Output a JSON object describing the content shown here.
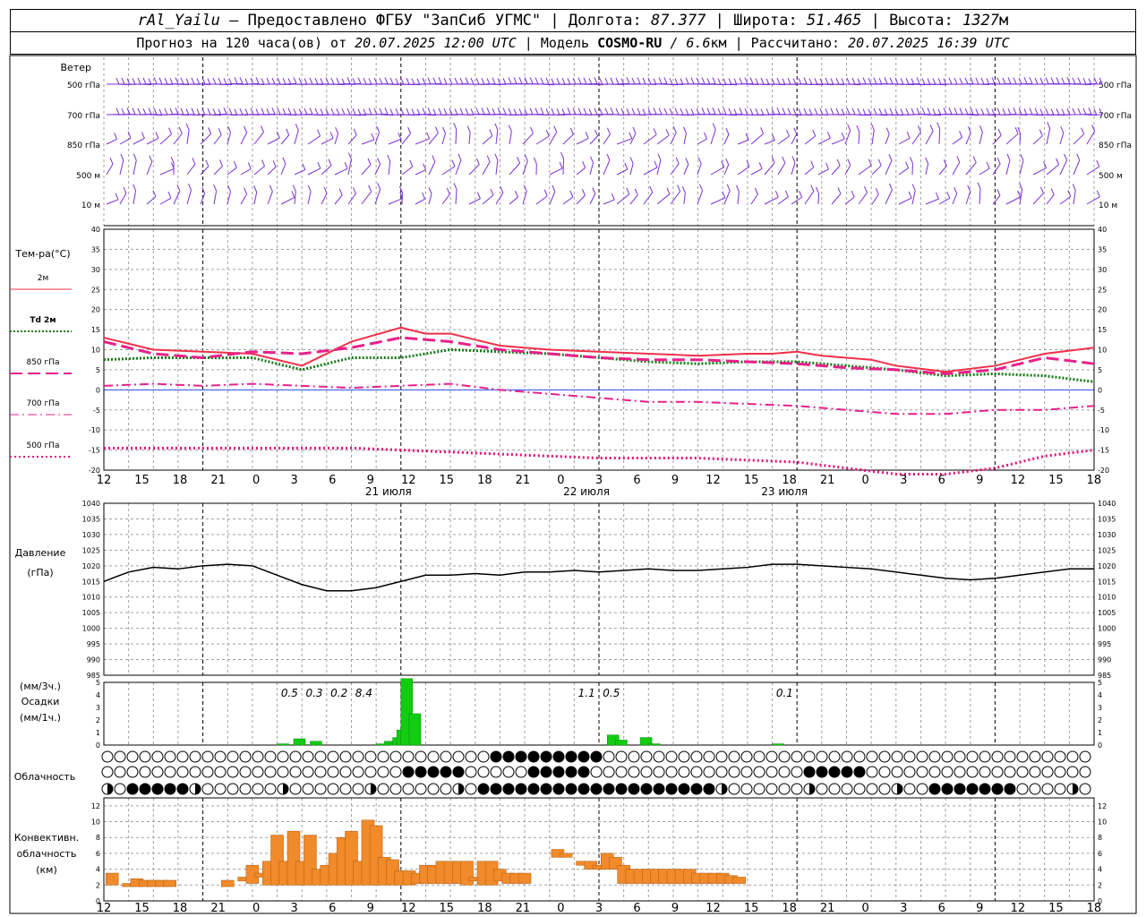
{
  "header": {
    "station": "rAl_Yailu",
    "provider_prefix": " — Предоставлено ФГБУ \"ЗапСиб УГМС\" | Долгота: ",
    "lon": "87.377",
    "lat_prefix": " | Широта: ",
    "lat": "51.465",
    "alt_prefix": " | Высота: ",
    "alt": "1327",
    "alt_unit": "м",
    "line2_prefix": "Прогноз на 120 часа(ов) от ",
    "forecast_from": "20.07.2025 12:00 UTC",
    "model_prefix": " | Модель ",
    "model": "COSMO-RU",
    "model_res": " / 6.6",
    "model_res_unit": "км",
    "calc_prefix": " | Рассчитано: ",
    "calculated": "20.07.2025 16:39 UTC"
  },
  "colors": {
    "wind": "#7a2fd6",
    "t2m": "#f0304a",
    "td2m": "#157a15",
    "t850": "#e8208a",
    "t700": "#e8208a",
    "t500": "#e0107a",
    "pressure": "#000000",
    "precip": "#12cc12",
    "convective": "#f08a2a",
    "grid": "#a0a0a0",
    "day_line": "#000000",
    "zero_line": "#3050ff"
  },
  "time_axis": {
    "hours": [
      "12",
      "15",
      "18",
      "21",
      "0",
      "3",
      "6",
      "9",
      "12",
      "15",
      "18",
      "21",
      "0",
      "3",
      "6",
      "9",
      "12",
      "15",
      "18",
      "21",
      "0",
      "3",
      "6",
      "9",
      "12",
      "15",
      "18"
    ],
    "dates": [
      "21 июля",
      "22 июля",
      "23 июля"
    ]
  },
  "wind_panel": {
    "title": "Ветер",
    "levels": [
      "500 гПа",
      "700 гПа",
      "850 гПа",
      "500 м",
      "10 м"
    ]
  },
  "chart_data": [
    {
      "type": "line",
      "id": "temperature",
      "ylabel": "Тем-ра(°С)",
      "ylim": [
        -20,
        40
      ],
      "yticks": [
        "-20",
        "-15",
        "-10",
        "-5",
        "0",
        "5",
        "10",
        "15",
        "20",
        "25",
        "30",
        "35",
        "40"
      ],
      "series": [
        {
          "name": "2м",
          "x_hours": [
            0,
            6,
            12,
            18,
            24,
            30,
            36,
            39,
            42,
            48,
            54,
            60,
            66,
            72,
            78,
            81,
            84,
            87,
            90,
            93,
            96,
            102,
            108,
            114,
            120
          ],
          "values": [
            13,
            10,
            9.5,
            9,
            6,
            12,
            15.5,
            14,
            14,
            11,
            10,
            9.5,
            9,
            8.5,
            9,
            9,
            9.5,
            8.5,
            8,
            7.5,
            6,
            4.5,
            6,
            9,
            10.5
          ]
        },
        {
          "name": "Td 2м",
          "x_hours": [
            0,
            6,
            12,
            18,
            24,
            30,
            36,
            42,
            48,
            54,
            60,
            66,
            72,
            78,
            84,
            90,
            96,
            102,
            108,
            114,
            120
          ],
          "values": [
            7.5,
            8,
            8,
            8,
            5,
            8,
            8,
            10,
            9.5,
            9,
            8,
            7,
            6.5,
            7,
            7,
            6,
            5,
            3.5,
            4,
            3.5,
            2
          ]
        },
        {
          "name": "850 гПа",
          "x_hours": [
            0,
            6,
            12,
            18,
            24,
            30,
            36,
            42,
            48,
            54,
            60,
            66,
            72,
            78,
            84,
            90,
            96,
            102,
            108,
            114,
            120
          ],
          "values": [
            12,
            9,
            8,
            9.5,
            9,
            10.5,
            13,
            12,
            10,
            9,
            8,
            7.5,
            7.5,
            7,
            6.5,
            5.5,
            5,
            4,
            5,
            8,
            6.5
          ]
        },
        {
          "name": "700 гПа",
          "x_hours": [
            0,
            6,
            12,
            18,
            24,
            30,
            36,
            42,
            48,
            54,
            60,
            66,
            72,
            78,
            84,
            90,
            96,
            102,
            108,
            114,
            120
          ],
          "values": [
            1,
            1.5,
            1,
            1.5,
            1,
            0.5,
            1,
            1.5,
            0,
            -1,
            -2,
            -3,
            -3,
            -3.5,
            -4,
            -5,
            -6,
            -6,
            -5,
            -5,
            -4
          ]
        },
        {
          "name": "500 гПа",
          "x_hours": [
            0,
            6,
            12,
            18,
            24,
            30,
            36,
            42,
            48,
            54,
            60,
            66,
            72,
            78,
            84,
            90,
            96,
            102,
            108,
            114,
            120
          ],
          "values": [
            -14.5,
            -14.5,
            -14.5,
            -14.5,
            -14.5,
            -14.5,
            -15,
            -15.5,
            -16,
            -16.5,
            -17,
            -17,
            -17,
            -17.5,
            -18,
            -19.5,
            -21,
            -21,
            -19.5,
            -16.5,
            -15
          ]
        }
      ]
    },
    {
      "type": "line",
      "id": "pressure",
      "ylabel": "Давление",
      "yunit": "(гПа)",
      "ylim": [
        985,
        1040
      ],
      "yticks": [
        "985",
        "990",
        "995",
        "1000",
        "1005",
        "1010",
        "1015",
        "1020",
        "1025",
        "1030",
        "1035",
        "1040"
      ],
      "series": [
        {
          "x_hours": [
            0,
            3,
            6,
            9,
            12,
            15,
            18,
            21,
            24,
            27,
            30,
            33,
            36,
            39,
            42,
            45,
            48,
            51,
            54,
            57,
            60,
            63,
            66,
            69,
            72,
            75,
            78,
            81,
            84,
            87,
            90,
            93,
            96,
            99,
            102,
            105,
            108,
            111,
            114,
            117,
            120
          ],
          "values": [
            1015,
            1018,
            1019.5,
            1019,
            1020,
            1020.5,
            1020,
            1017,
            1014,
            1012,
            1012,
            1013,
            1015,
            1017,
            1017,
            1017.5,
            1017,
            1018,
            1018,
            1018.5,
            1018,
            1018.5,
            1019,
            1018.5,
            1018.5,
            1019,
            1019.5,
            1020.5,
            1020.5,
            1020,
            1019.5,
            1019,
            1018,
            1017,
            1016,
            1015.5,
            1016,
            1017,
            1018,
            1019,
            1019
          ]
        }
      ]
    },
    {
      "type": "bar",
      "id": "precipitation",
      "ylabel": "(мм/3ч.)",
      "title": "Осадки",
      "yunit": "(мм/1ч.)",
      "ylim": [
        0,
        5
      ],
      "yticks": [
        "0",
        "1",
        "2",
        "3",
        "4",
        "5"
      ],
      "bars_hour": [
        21,
        22,
        23,
        24,
        25,
        26,
        33,
        34,
        34.5,
        35,
        35.5,
        36,
        37,
        38,
        39,
        40,
        41,
        61,
        62,
        63,
        64,
        65,
        66,
        81,
        82
      ],
      "values": [
        0.1,
        0,
        0.5,
        0,
        0.3,
        0,
        0.1,
        0.3,
        0.2,
        0.6,
        1.2,
        5.3,
        2.5,
        0,
        0,
        0,
        0,
        0.8,
        0.4,
        0,
        0,
        0.6,
        0.1,
        0.1,
        0
      ],
      "labels": [
        {
          "text": "0.5",
          "x_hour": 22.5
        },
        {
          "text": "0.3",
          "x_hour": 25.5
        },
        {
          "text": "0.2",
          "x_hour": 28.5
        },
        {
          "text": "8.4",
          "x_hour": 31.5
        },
        {
          "text": "1.1",
          "x_hour": 58.5
        },
        {
          "text": "0.5",
          "x_hour": 61.5
        },
        {
          "text": "0.1",
          "x_hour": 82.5
        }
      ]
    },
    {
      "type": "table",
      "id": "cloudiness",
      "ylabel": "Облачность",
      "rows_octas": [
        [
          0,
          0,
          0,
          0,
          0,
          0,
          0,
          0,
          0,
          0,
          0,
          0,
          0,
          0,
          0,
          0,
          0,
          0,
          0,
          0,
          0,
          0,
          0,
          0,
          0,
          0,
          0,
          0,
          0,
          0,
          0,
          0,
          0,
          0,
          0,
          0,
          0,
          0,
          0,
          0,
          0,
          0,
          0,
          0,
          0,
          0,
          0,
          0,
          0,
          0,
          0,
          0,
          0,
          0,
          0,
          0,
          0,
          0,
          0,
          0,
          0,
          0,
          0,
          0,
          0,
          0,
          0,
          0,
          0,
          0,
          0,
          0,
          0,
          0,
          0,
          0,
          0,
          0,
          0,
          0,
          0,
          0,
          0,
          0,
          0,
          0,
          0,
          0,
          0,
          0,
          0,
          0,
          0,
          0,
          0,
          0,
          0,
          0,
          0,
          0,
          0,
          0,
          0,
          0,
          0,
          0,
          0,
          0,
          0,
          0,
          0,
          0,
          0,
          0,
          0,
          0,
          0,
          0,
          0,
          0,
          0
        ],
        [
          0,
          0,
          0,
          0,
          0,
          0,
          0,
          0,
          0,
          0,
          0,
          0,
          0,
          0,
          0,
          0,
          0,
          0,
          0,
          0,
          0,
          0,
          0,
          0,
          0,
          0,
          0,
          0,
          0,
          0,
          0,
          0,
          0,
          0,
          0,
          0,
          0,
          0,
          0,
          0,
          0,
          0,
          0,
          0,
          0,
          0,
          0,
          0,
          0,
          0,
          0,
          0,
          0,
          0,
          0,
          0,
          0,
          0,
          0,
          0,
          0,
          0,
          0,
          0,
          0,
          0,
          0,
          0,
          0,
          0,
          0,
          0,
          0,
          0,
          0,
          0,
          0,
          0,
          0,
          0,
          0,
          0,
          0,
          0,
          0,
          0,
          0,
          0,
          0,
          0,
          0,
          0,
          0,
          0,
          0,
          0,
          0,
          0,
          0,
          0,
          0,
          0,
          0,
          0,
          0,
          0,
          0,
          0,
          0,
          0,
          0,
          0,
          0,
          0,
          0,
          0,
          0,
          0,
          0,
          0,
          0
        ],
        [
          0,
          0,
          0,
          0,
          0,
          0,
          0,
          0,
          0,
          0,
          0,
          0,
          0,
          0,
          0,
          0,
          0,
          0,
          0,
          0,
          0,
          0,
          0,
          0,
          0,
          0,
          0,
          0,
          0,
          0,
          0,
          0,
          0,
          0,
          0,
          0,
          0,
          0,
          0,
          0,
          0,
          0,
          0,
          0,
          0,
          0,
          0,
          0,
          0,
          0,
          0,
          0,
          0,
          0,
          0,
          0,
          0,
          0,
          0,
          0,
          0,
          0,
          0,
          0,
          0,
          0,
          0,
          0,
          0,
          0,
          0,
          0,
          0,
          0,
          0,
          0,
          0,
          0,
          0,
          0,
          0,
          0,
          0,
          0,
          0,
          0,
          0,
          0,
          0,
          0,
          0,
          0,
          0,
          0,
          0,
          0,
          0,
          0,
          0,
          0,
          0,
          0,
          0,
          0,
          0,
          0,
          0,
          0,
          0,
          0,
          0,
          0,
          0,
          0,
          0,
          0,
          0,
          0,
          0,
          0,
          0
        ]
      ]
    },
    {
      "type": "bar",
      "id": "convective",
      "ylabel": "Конвективн.",
      "ylabel2": "облачность",
      "yunit": "(км)",
      "ylim": [
        0,
        13
      ],
      "yticks": [
        "0",
        "2",
        "4",
        "6",
        "8",
        "10",
        "12"
      ],
      "bars": [
        {
          "h": 1,
          "lo": 2,
          "hi": 3.5
        },
        {
          "h": 3,
          "lo": 1.8,
          "hi": 2.2
        },
        {
          "h": 4,
          "lo": 1.8,
          "hi": 2.8
        },
        {
          "h": 5,
          "lo": 1.8,
          "hi": 2.6
        },
        {
          "h": 6,
          "lo": 1.8,
          "hi": 2.6
        },
        {
          "h": 7,
          "lo": 1.8,
          "hi": 2.6
        },
        {
          "h": 8,
          "lo": 1.8,
          "hi": 2.6
        },
        {
          "h": 15,
          "lo": 1.8,
          "hi": 2.6
        },
        {
          "h": 17,
          "lo": 2.5,
          "hi": 3
        },
        {
          "h": 18,
          "lo": 2.2,
          "hi": 4.5
        },
        {
          "h": 19,
          "lo": 3,
          "hi": 3.5
        },
        {
          "h": 20,
          "lo": 2,
          "hi": 5
        },
        {
          "h": 21,
          "lo": 2,
          "hi": 8.3
        },
        {
          "h": 22,
          "lo": 2,
          "hi": 5
        },
        {
          "h": 23,
          "lo": 2,
          "hi": 8.8
        },
        {
          "h": 24,
          "lo": 2,
          "hi": 5
        },
        {
          "h": 25,
          "lo": 2,
          "hi": 8.3
        },
        {
          "h": 26,
          "lo": 2,
          "hi": 4
        },
        {
          "h": 27,
          "lo": 2,
          "hi": 4.5
        },
        {
          "h": 28,
          "lo": 2,
          "hi": 6
        },
        {
          "h": 29,
          "lo": 2,
          "hi": 8
        },
        {
          "h": 30,
          "lo": 2,
          "hi": 8.8
        },
        {
          "h": 31,
          "lo": 2,
          "hi": 5
        },
        {
          "h": 32,
          "lo": 2,
          "hi": 10.2
        },
        {
          "h": 33,
          "lo": 2,
          "hi": 9.5
        },
        {
          "h": 34,
          "lo": 2,
          "hi": 5.5
        },
        {
          "h": 35,
          "lo": 2,
          "hi": 5.2
        },
        {
          "h": 36,
          "lo": 2,
          "hi": 3.8
        },
        {
          "h": 37,
          "lo": 2,
          "hi": 3.8
        },
        {
          "h": 38,
          "lo": 2.2,
          "hi": 3.5
        },
        {
          "h": 39,
          "lo": 2.2,
          "hi": 4.5
        },
        {
          "h": 40,
          "lo": 2.2,
          "hi": 4.5
        },
        {
          "h": 41,
          "lo": 2.2,
          "hi": 5
        },
        {
          "h": 42,
          "lo": 2.2,
          "hi": 5
        },
        {
          "h": 43,
          "lo": 2.2,
          "hi": 5
        },
        {
          "h": 44,
          "lo": 2,
          "hi": 5
        },
        {
          "h": 45,
          "lo": 2.5,
          "hi": 3
        },
        {
          "h": 46,
          "lo": 2,
          "hi": 5
        },
        {
          "h": 47,
          "lo": 2,
          "hi": 5
        },
        {
          "h": 48,
          "lo": 2.5,
          "hi": 4
        },
        {
          "h": 49,
          "lo": 2.2,
          "hi": 3.5
        },
        {
          "h": 50,
          "lo": 2.2,
          "hi": 3.5
        },
        {
          "h": 51,
          "lo": 2.2,
          "hi": 3.5
        },
        {
          "h": 55,
          "lo": 5.5,
          "hi": 6.5
        },
        {
          "h": 56,
          "lo": 5.5,
          "hi": 6
        },
        {
          "h": 58,
          "lo": 4.5,
          "hi": 5
        },
        {
          "h": 59,
          "lo": 4,
          "hi": 5
        },
        {
          "h": 60,
          "lo": 4,
          "hi": 4.5
        },
        {
          "h": 61,
          "lo": 4,
          "hi": 6
        },
        {
          "h": 62,
          "lo": 4,
          "hi": 5.5
        },
        {
          "h": 63,
          "lo": 2.2,
          "hi": 4.5
        },
        {
          "h": 64,
          "lo": 2.2,
          "hi": 4
        },
        {
          "h": 65,
          "lo": 2.2,
          "hi": 4
        },
        {
          "h": 66,
          "lo": 2.2,
          "hi": 4
        },
        {
          "h": 67,
          "lo": 2.2,
          "hi": 4
        },
        {
          "h": 68,
          "lo": 2.2,
          "hi": 4
        },
        {
          "h": 69,
          "lo": 2.2,
          "hi": 4
        },
        {
          "h": 70,
          "lo": 2.2,
          "hi": 4
        },
        {
          "h": 71,
          "lo": 2.2,
          "hi": 4
        },
        {
          "h": 72,
          "lo": 2.2,
          "hi": 3.5
        },
        {
          "h": 73,
          "lo": 2.2,
          "hi": 3.5
        },
        {
          "h": 74,
          "lo": 2.2,
          "hi": 3.5
        },
        {
          "h": 75,
          "lo": 2.2,
          "hi": 3.5
        },
        {
          "h": 76,
          "lo": 2.2,
          "hi": 3.2
        },
        {
          "h": 77,
          "lo": 2.2,
          "hi": 3
        }
      ]
    }
  ]
}
